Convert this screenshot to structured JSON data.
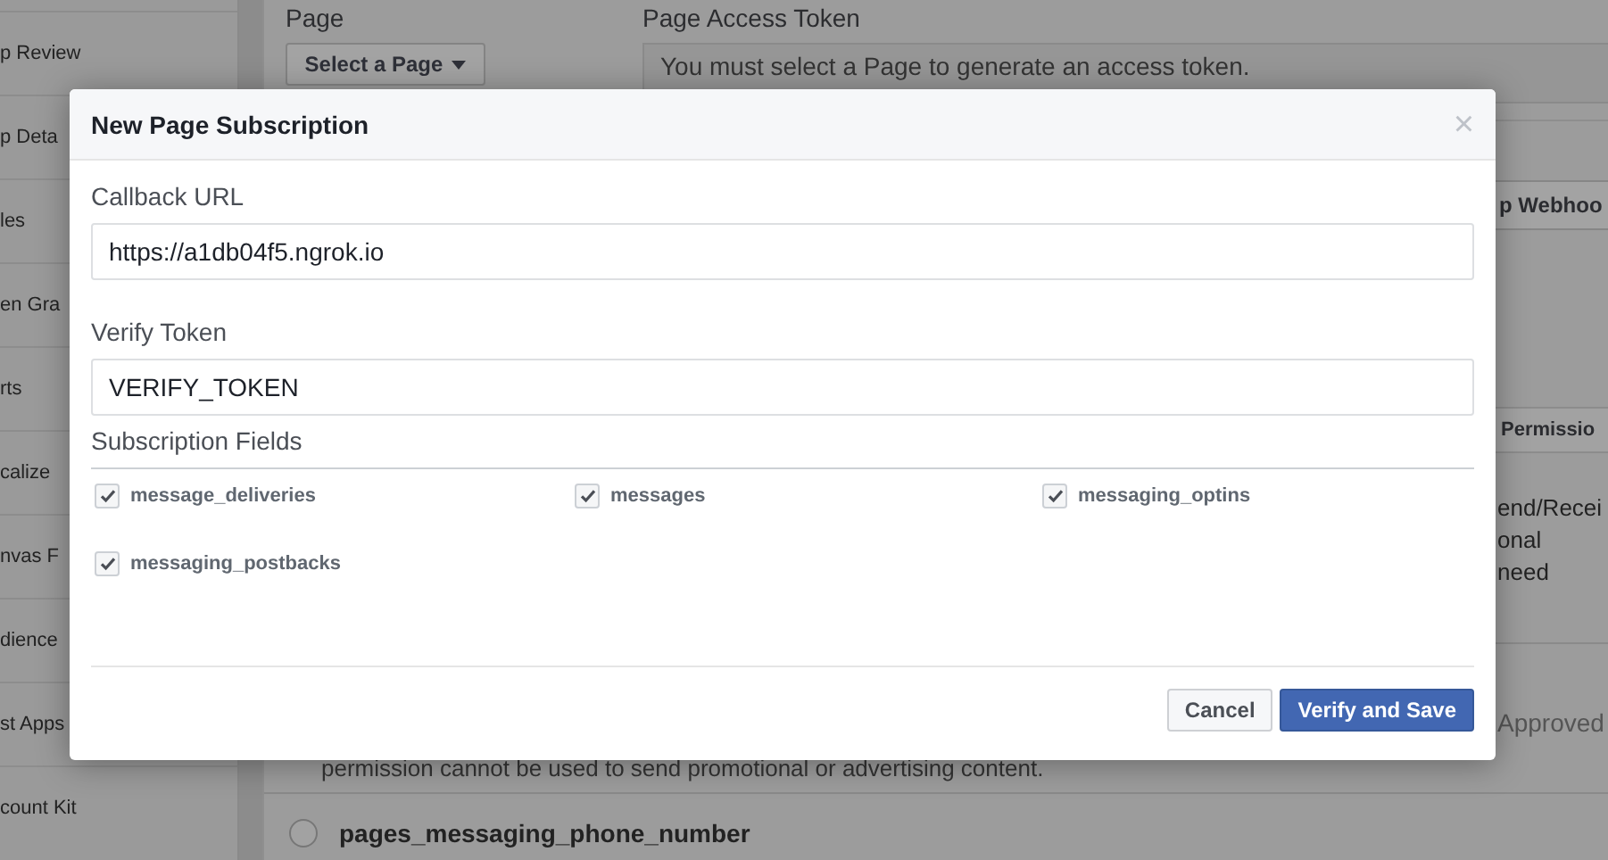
{
  "sidebar": {
    "items": [
      "p Review",
      "p Deta",
      "les",
      "en Gra",
      "rts",
      "calize",
      "nvas F",
      "dience",
      "st Apps",
      "count Kit"
    ]
  },
  "page_section": {
    "page_label": "Page",
    "select_button": "Select a Page",
    "token_label": "Page Access Token",
    "token_field": "You must select a Page to generate an access token."
  },
  "webhooks_button": "p Webhoo",
  "permissions_header": "Permissio",
  "description_lines": [
    "end/Recei",
    "onal",
    "need"
  ],
  "status": "Approved",
  "permission_note": "permission cannot be used to send promotional or advertising content.",
  "next_permission": {
    "name": "pages_messaging_phone_number",
    "selected": false
  },
  "dialog": {
    "title": "New Page Subscription",
    "close": "×",
    "fields": [
      {
        "label": "Callback URL",
        "value": "https://a1db04f5.ngrok.io"
      },
      {
        "label": "Verify Token",
        "value": "VERIFY_TOKEN"
      }
    ],
    "subscription": {
      "label": "Subscription Fields",
      "options": [
        {
          "label": "message_deliveries",
          "checked": true
        },
        {
          "label": "messages",
          "checked": true
        },
        {
          "label": "messaging_optins",
          "checked": true
        },
        {
          "label": "messaging_postbacks",
          "checked": true
        }
      ]
    },
    "buttons": [
      {
        "label": "Cancel",
        "kind": "secondary"
      },
      {
        "label": "Verify and Save",
        "kind": "primary"
      }
    ]
  }
}
